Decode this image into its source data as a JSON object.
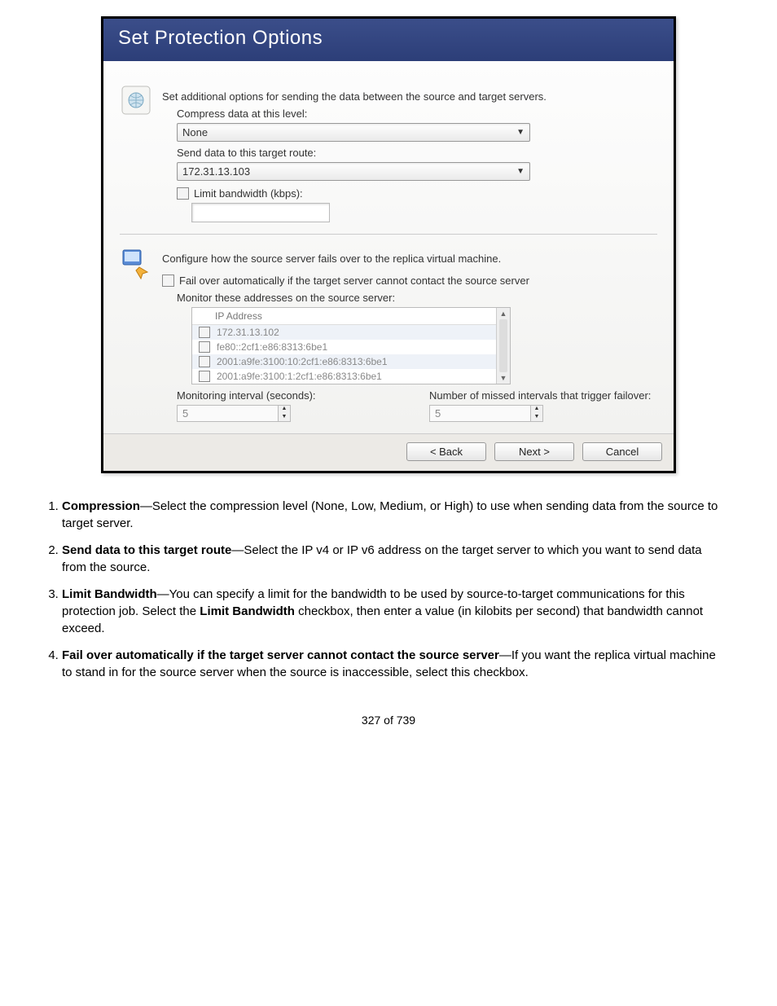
{
  "dialog": {
    "title": "Set Protection Options",
    "section1": {
      "intro": "Set additional options for sending the data between the source and target servers.",
      "compress_label": "Compress data at this level:",
      "compress_value": "None",
      "route_label": "Send data to this target route:",
      "route_value": "172.31.13.103",
      "limit_label": "Limit bandwidth (kbps):"
    },
    "section2": {
      "intro": "Configure how the source server fails over to the replica virtual machine.",
      "failover_label": "Fail over automatically if the target server cannot contact the source server",
      "monitor_label": "Monitor these addresses on the source server:",
      "columns": {
        "ip": "IP Address"
      },
      "rows": [
        "172.31.13.102",
        "fe80::2cf1:e86:8313:6be1",
        "2001:a9fe:3100:10:2cf1:e86:8313:6be1",
        "2001:a9fe:3100:1:2cf1:e86:8313:6be1"
      ],
      "interval_label": "Monitoring interval (seconds):",
      "interval_value": "5",
      "missed_label": "Number of missed intervals that trigger failover:",
      "missed_value": "5"
    },
    "buttons": {
      "back": "< Back",
      "next": "Next >",
      "cancel": "Cancel"
    }
  },
  "doc": {
    "items": [
      {
        "term": "Compression",
        "body": "—Select the compression level (None, Low, Medium, or High) to use when sending data from the source to target server."
      },
      {
        "term": "Send data to this target route",
        "body": "—Select the IP v4 or IP v6 address on the target server to which you want to send data from the source."
      },
      {
        "term": "Limit Bandwidth",
        "body": "—You can specify a limit for the bandwidth to be used by source-to-target communications for this protection job. Select the ",
        "term2": "Limit Bandwidth",
        "body2": " checkbox, then enter a value (in kilobits per second) that bandwidth cannot exceed."
      },
      {
        "term": "Fail over automatically if the target server cannot contact the source server",
        "body": "—If you want the replica virtual machine to stand in for the source server when the source is inaccessible, select this checkbox."
      }
    ],
    "page": "327 of 739"
  }
}
